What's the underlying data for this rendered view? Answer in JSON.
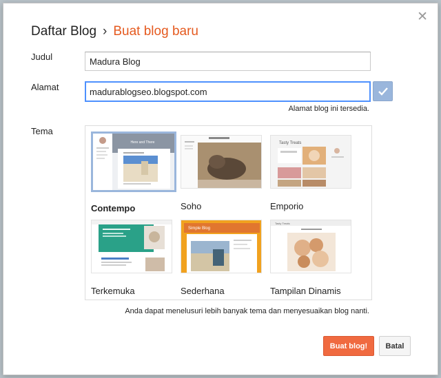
{
  "header": {
    "breadcrumb_root": "Daftar Blog",
    "separator": "›",
    "breadcrumb_current": "Buat blog baru",
    "close_label": "✕"
  },
  "form": {
    "title_label": "Judul",
    "title_value": "Madura Blog",
    "address_label": "Alamat",
    "address_value": "madurablogseo.blogspot.com",
    "availability_text": "Alamat blog ini tersedia.",
    "theme_label": "Tema"
  },
  "themes": [
    {
      "name": "Contempo",
      "selected": true
    },
    {
      "name": "Soho",
      "selected": false
    },
    {
      "name": "Emporio",
      "selected": false
    },
    {
      "name": "Terkemuka",
      "selected": false
    },
    {
      "name": "Sederhana",
      "selected": false
    },
    {
      "name": "Tampilan Dinamis",
      "selected": false
    }
  ],
  "theme_thumb_text": {
    "contempo_header": "Here and There",
    "emporio_header": "Tasty Treats",
    "sederhana_header": "Simple Blog",
    "dinamis_header": "Tasty Treats"
  },
  "hint": "Anda dapat menelusuri lebih banyak tema dan menyesuaikan blog nanti.",
  "buttons": {
    "create": "Buat blog!",
    "cancel": "Batal"
  },
  "colors": {
    "accent": "#e55a1f",
    "primary_button": "#f06a40",
    "focus": "#4d90fe",
    "check_button": "#9ab6dc"
  },
  "icons": {
    "close": "close-icon",
    "check": "check-icon"
  }
}
